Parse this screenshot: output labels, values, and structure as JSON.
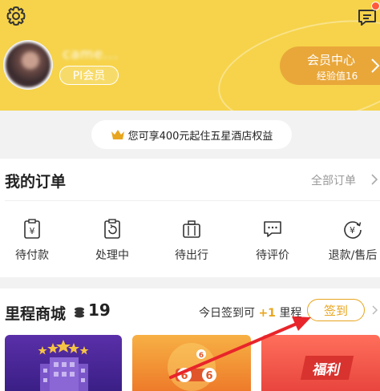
{
  "header": {
    "settings_icon": "gear-icon",
    "messages_icon": "message-icon",
    "username": "came...",
    "member_badge": "PI会员",
    "member_center": {
      "title": "会员中心",
      "subtitle": "经验值16"
    }
  },
  "promo": {
    "text": "您可享400元起住五星酒店权益",
    "icon": "crown-icon"
  },
  "orders": {
    "title": "我的订单",
    "all_link": "全部订单",
    "items": [
      {
        "label": "待付款",
        "icon": "wallet-icon"
      },
      {
        "label": "处理中",
        "icon": "processing-icon"
      },
      {
        "label": "待出行",
        "icon": "luggage-icon"
      },
      {
        "label": "待评价",
        "icon": "comment-icon"
      },
      {
        "label": "退款/售后",
        "icon": "refund-icon"
      }
    ]
  },
  "mall": {
    "title": "里程商城",
    "points": "19",
    "sign_prefix": "今日签到可",
    "sign_plus": "+1",
    "sign_suffix": "里程",
    "sign_button": "签到",
    "tile3_label": "福利"
  },
  "colors": {
    "header_bg": "#f6d34a",
    "accent": "#e8a51e",
    "annotation": "#e8252a"
  }
}
